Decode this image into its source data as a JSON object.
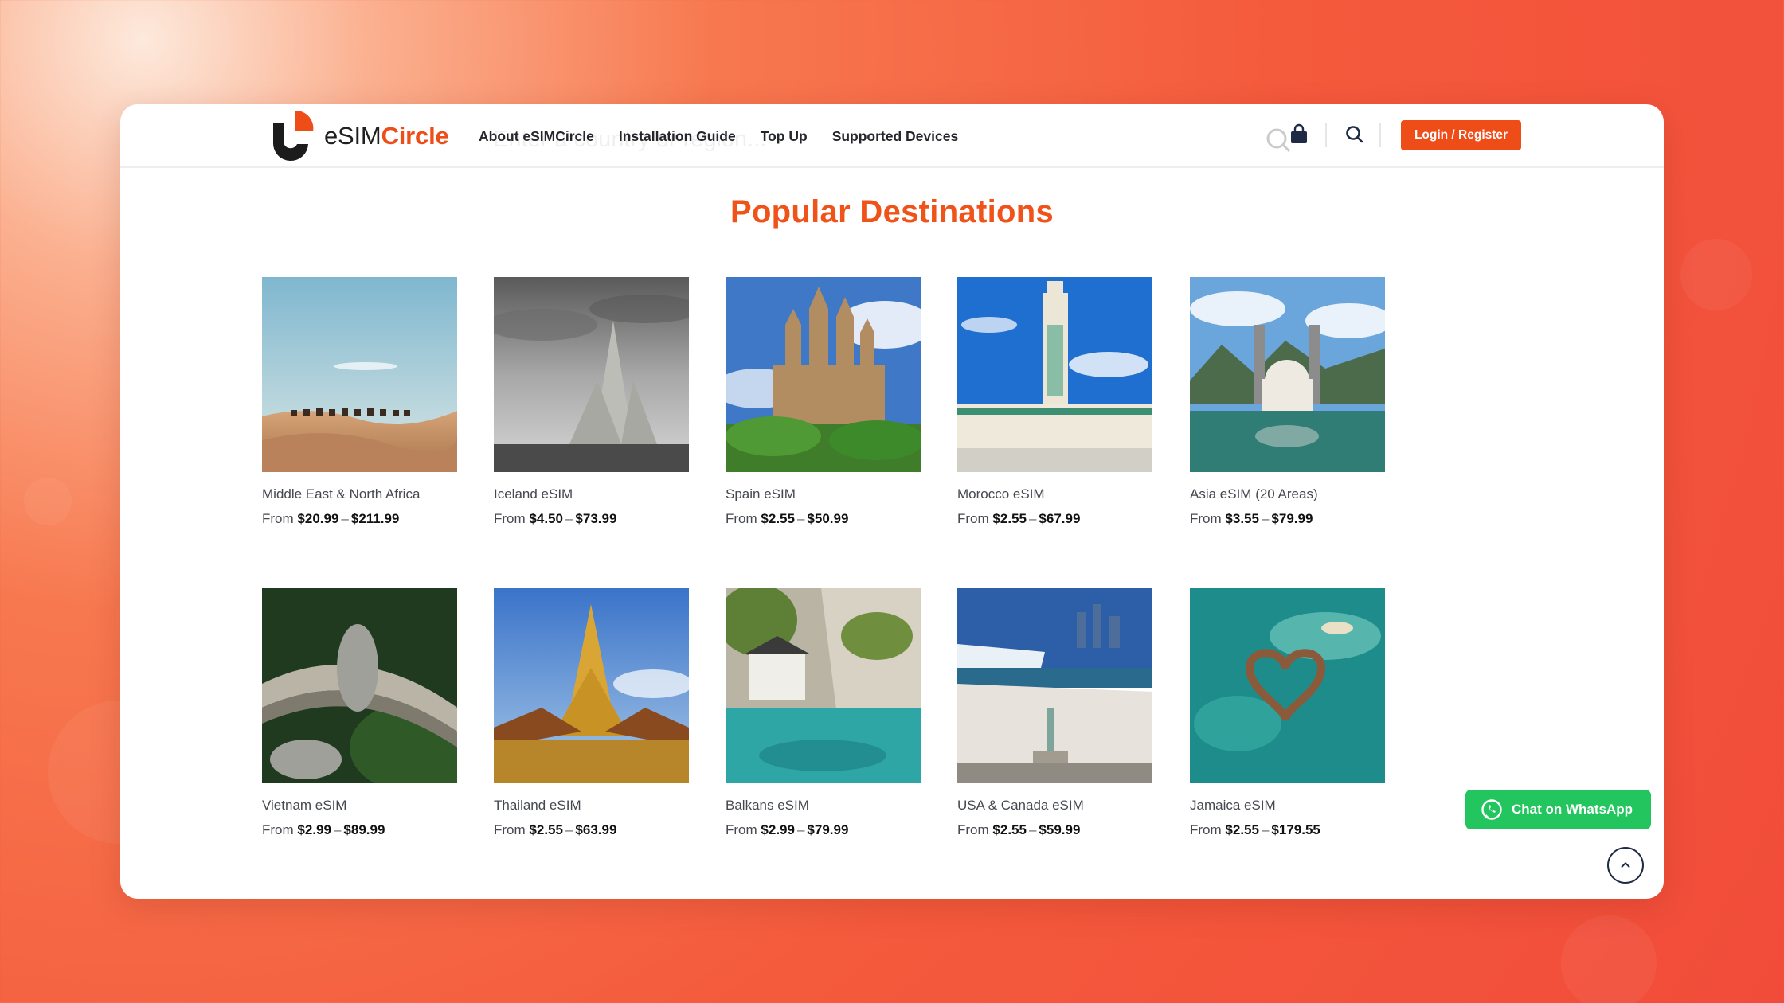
{
  "brand": {
    "logo_part1": "eSIM",
    "logo_part2": "Circle",
    "accent": "#ee4d18"
  },
  "nav": [
    {
      "label": "About eSIMCircle"
    },
    {
      "label": "Installation Guide"
    },
    {
      "label": "Top Up"
    },
    {
      "label": "Supported Devices"
    }
  ],
  "search": {
    "placeholder": "Enter a country or region..."
  },
  "header": {
    "login_label": "Login / Register"
  },
  "section": {
    "title": "Popular Destinations"
  },
  "products": [
    {
      "name": "Middle East & North Africa",
      "from_label": "From",
      "price_min": "$20.99",
      "price_max": "$211.99",
      "image": "desert-camels"
    },
    {
      "name": "Iceland eSIM",
      "from_label": "From",
      "price_min": "$4.50",
      "price_max": "$73.99",
      "image": "hallgrimskirkja"
    },
    {
      "name": "Spain eSIM",
      "from_label": "From",
      "price_min": "$2.55",
      "price_max": "$50.99",
      "image": "sagrada-familia"
    },
    {
      "name": "Morocco eSIM",
      "from_label": "From",
      "price_min": "$2.55",
      "price_max": "$67.99",
      "image": "hassan-mosque"
    },
    {
      "name": "Asia eSIM (20 Areas)",
      "from_label": "From",
      "price_min": "$3.55",
      "price_max": "$79.99",
      "image": "asia-landmarks"
    },
    {
      "name": "Vietnam eSIM",
      "from_label": "From",
      "price_min": "$2.99",
      "price_max": "$89.99",
      "image": "golden-bridge"
    },
    {
      "name": "Thailand eSIM",
      "from_label": "From",
      "price_min": "$2.55",
      "price_max": "$63.99",
      "image": "golden-pagoda"
    },
    {
      "name": "Balkans eSIM",
      "from_label": "From",
      "price_min": "$2.99",
      "price_max": "$79.99",
      "image": "cliff-river-house"
    },
    {
      "name": "USA & Canada eSIM",
      "from_label": "From",
      "price_min": "$2.55",
      "price_max": "$59.99",
      "image": "niagara-liberty"
    },
    {
      "name": "Jamaica eSIM",
      "from_label": "From",
      "price_min": "$2.55",
      "price_max": "$179.55",
      "image": "overwater-bungalows"
    }
  ],
  "whatsapp": {
    "label": "Chat on WhatsApp",
    "color": "#22c55e"
  }
}
